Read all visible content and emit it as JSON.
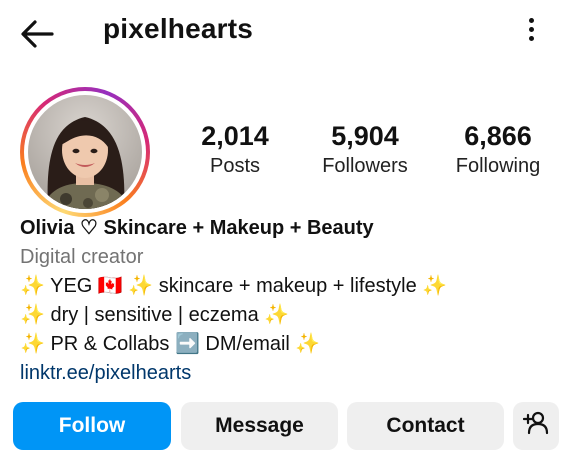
{
  "header": {
    "back_icon": "arrow-left-icon",
    "username": "pixelhearts",
    "more_icon": "more-vertical-icon"
  },
  "profile": {
    "avatar_description": "profile photo",
    "story_ring_colors": [
      "#feda75",
      "#fa7e1e",
      "#d62976",
      "#962fbf"
    ]
  },
  "stats": [
    {
      "value": "2,014",
      "label": "Posts"
    },
    {
      "value": "5,904",
      "label": "Followers"
    },
    {
      "value": "6,866",
      "label": "Following"
    }
  ],
  "bio": {
    "display_name": "Olivia ♡ Skincare + Makeup + Beauty",
    "category": "Digital creator",
    "lines": [
      "✨ YEG 🇨🇦 ✨ skincare + makeup + lifestyle ✨",
      "✨ dry | sensitive | eczema ✨",
      "✨ PR & Collabs ➡️ DM/email ✨"
    ],
    "link": "linktr.ee/pixelhearts"
  },
  "actions": {
    "follow": "Follow",
    "message": "Message",
    "contact": "Contact",
    "suggest_icon": "add-person-icon"
  },
  "colors": {
    "follow_button": "#0095f6",
    "secondary_button": "#efefef",
    "link": "#00376b",
    "muted_text": "#737373"
  }
}
